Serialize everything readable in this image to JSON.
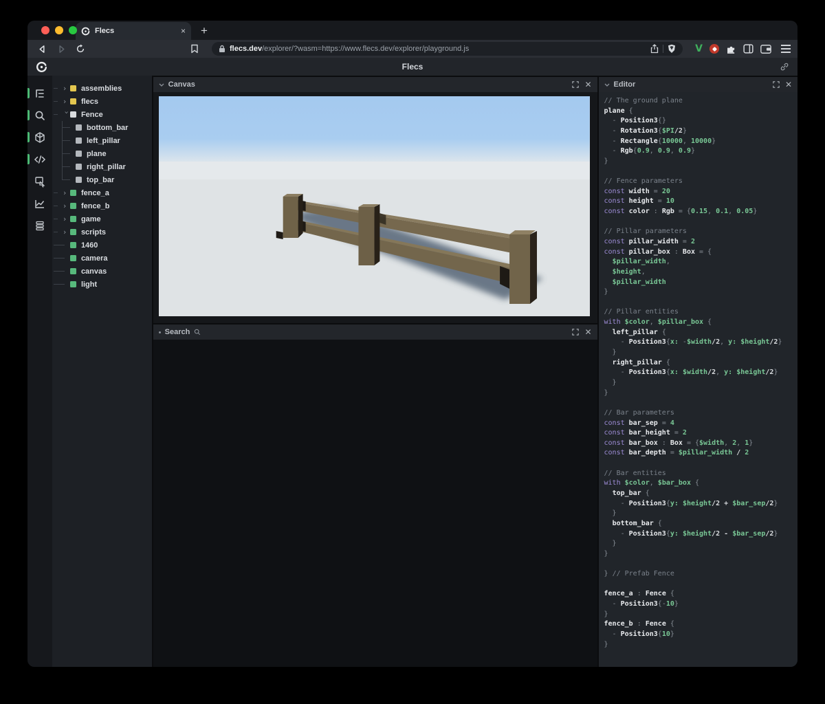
{
  "browser": {
    "tab_title": "Flecs",
    "tab_close": "×",
    "new_tab": "+",
    "url_host": "flecs.dev",
    "url_path": "/explorer/?wasm=https://www.flecs.dev/explorer/playground.js",
    "v_extension_label": "V"
  },
  "header": {
    "title": "Flecs"
  },
  "sidebar_icons": [
    {
      "name": "hierarchy-icon",
      "active": true
    },
    {
      "name": "search-icon",
      "active": true
    },
    {
      "name": "cube-icon",
      "active": true
    },
    {
      "name": "code-icon",
      "active": true
    },
    {
      "name": "inspect-icon",
      "active": false
    },
    {
      "name": "chart-icon",
      "active": false
    },
    {
      "name": "queue-icon",
      "active": false
    }
  ],
  "tree": {
    "items": [
      {
        "label": "assemblies",
        "square": "yellow",
        "state": "collapsed",
        "depth": 0
      },
      {
        "label": "flecs",
        "square": "yellow",
        "state": "collapsed",
        "depth": 0
      },
      {
        "label": "Fence",
        "square": "white",
        "state": "expanded",
        "depth": 0
      },
      {
        "label": "bottom_bar",
        "square": "gray",
        "state": "child",
        "depth": 1,
        "last": false
      },
      {
        "label": "left_pillar",
        "square": "gray",
        "state": "child",
        "depth": 1,
        "last": false
      },
      {
        "label": "plane",
        "square": "gray",
        "state": "child",
        "depth": 1,
        "last": false
      },
      {
        "label": "right_pillar",
        "square": "gray",
        "state": "child",
        "depth": 1,
        "last": false
      },
      {
        "label": "top_bar",
        "square": "gray",
        "state": "child",
        "depth": 1,
        "last": true
      },
      {
        "label": "fence_a",
        "square": "green",
        "state": "collapsed",
        "depth": 0
      },
      {
        "label": "fence_b",
        "square": "green",
        "state": "collapsed",
        "depth": 0
      },
      {
        "label": "game",
        "square": "green",
        "state": "collapsed",
        "depth": 0
      },
      {
        "label": "scripts",
        "square": "green",
        "state": "collapsed",
        "depth": 0
      },
      {
        "label": "1460",
        "square": "green",
        "state": "leaf",
        "depth": 0
      },
      {
        "label": "camera",
        "square": "green",
        "state": "leaf",
        "depth": 0
      },
      {
        "label": "canvas",
        "square": "green",
        "state": "leaf",
        "depth": 0
      },
      {
        "label": "light",
        "square": "green",
        "state": "leaf",
        "depth": 0
      }
    ]
  },
  "panels": {
    "canvas": {
      "title": "Canvas"
    },
    "search": {
      "title": "Search"
    },
    "editor": {
      "title": "Editor"
    }
  },
  "colors": {
    "accent_green": "#4cba74",
    "square_yellow": "#e3c64f",
    "square_white": "#d8dbde",
    "square_gray": "#b4b8bd",
    "square_green": "#57b97c",
    "sky": "#a4c9ef",
    "ground": "#dfe3e5",
    "fence_front": "#73664c",
    "fence_top": "#8a7c60",
    "fence_dark": "#26201a",
    "shadow": "#4e5d6f",
    "traffic_red": "#ff5f57",
    "traffic_yellow": "#febc2e",
    "traffic_green": "#28c840"
  },
  "code": {
    "lines": [
      [
        [
          "c",
          "// The ground plane"
        ]
      ],
      [
        [
          "i",
          "plane"
        ],
        [
          "o",
          " {"
        ]
      ],
      [
        [
          "o",
          "  - "
        ],
        [
          "i",
          "Position3"
        ],
        [
          "o",
          "{}"
        ]
      ],
      [
        [
          "o",
          "  - "
        ],
        [
          "i",
          "Rotation3"
        ],
        [
          "o",
          "{"
        ],
        [
          "v",
          "$PI"
        ],
        [
          "p",
          "/2"
        ],
        [
          "o",
          "}"
        ]
      ],
      [
        [
          "o",
          "  - "
        ],
        [
          "i",
          "Rectangle"
        ],
        [
          "o",
          "{"
        ],
        [
          "v",
          "10000"
        ],
        [
          "o",
          ", "
        ],
        [
          "v",
          "10000"
        ],
        [
          "o",
          "}"
        ]
      ],
      [
        [
          "o",
          "  - "
        ],
        [
          "i",
          "Rgb"
        ],
        [
          "o",
          "{"
        ],
        [
          "v",
          "0.9"
        ],
        [
          "o",
          ", "
        ],
        [
          "v",
          "0.9"
        ],
        [
          "o",
          ", "
        ],
        [
          "v",
          "0.9"
        ],
        [
          "o",
          "}"
        ]
      ],
      [
        [
          "o",
          "}"
        ]
      ],
      [],
      [
        [
          "c",
          "// Fence parameters"
        ]
      ],
      [
        [
          "k",
          "const "
        ],
        [
          "i",
          "width"
        ],
        [
          "o",
          " = "
        ],
        [
          "v",
          "20"
        ]
      ],
      [
        [
          "k",
          "const "
        ],
        [
          "i",
          "height"
        ],
        [
          "o",
          " = "
        ],
        [
          "v",
          "10"
        ]
      ],
      [
        [
          "k",
          "const "
        ],
        [
          "i",
          "color"
        ],
        [
          "o",
          " : "
        ],
        [
          "i",
          "Rgb"
        ],
        [
          "o",
          " = {"
        ],
        [
          "v",
          "0.15"
        ],
        [
          "o",
          ", "
        ],
        [
          "v",
          "0.1"
        ],
        [
          "o",
          ", "
        ],
        [
          "v",
          "0.05"
        ],
        [
          "o",
          "}"
        ]
      ],
      [],
      [
        [
          "c",
          "// Pillar parameters"
        ]
      ],
      [
        [
          "k",
          "const "
        ],
        [
          "i",
          "pillar_width"
        ],
        [
          "o",
          " = "
        ],
        [
          "v",
          "2"
        ]
      ],
      [
        [
          "k",
          "const "
        ],
        [
          "i",
          "pillar_box"
        ],
        [
          "o",
          " : "
        ],
        [
          "i",
          "Box"
        ],
        [
          "o",
          " = {"
        ]
      ],
      [
        [
          "o",
          "  "
        ],
        [
          "v",
          "$pillar_width"
        ],
        [
          "o",
          ","
        ]
      ],
      [
        [
          "o",
          "  "
        ],
        [
          "v",
          "$height"
        ],
        [
          "o",
          ","
        ]
      ],
      [
        [
          "o",
          "  "
        ],
        [
          "v",
          "$pillar_width"
        ]
      ],
      [
        [
          "o",
          "}"
        ]
      ],
      [],
      [
        [
          "c",
          "// Pillar entities"
        ]
      ],
      [
        [
          "k",
          "with "
        ],
        [
          "v",
          "$color"
        ],
        [
          "o",
          ", "
        ],
        [
          "v",
          "$pillar_box"
        ],
        [
          "o",
          " {"
        ]
      ],
      [
        [
          "o",
          "  "
        ],
        [
          "i",
          "left_pillar"
        ],
        [
          "o",
          " {"
        ]
      ],
      [
        [
          "o",
          "    - "
        ],
        [
          "i",
          "Position3"
        ],
        [
          "o",
          "{"
        ],
        [
          "v",
          "x:"
        ],
        [
          "o",
          " -"
        ],
        [
          "v",
          "$width"
        ],
        [
          "p",
          "/2"
        ],
        [
          "o",
          ", "
        ],
        [
          "v",
          "y:"
        ],
        [
          "o",
          " "
        ],
        [
          "v",
          "$height"
        ],
        [
          "p",
          "/2"
        ],
        [
          "o",
          "}"
        ]
      ],
      [
        [
          "o",
          "  }"
        ]
      ],
      [
        [
          "o",
          "  "
        ],
        [
          "i",
          "right_pillar"
        ],
        [
          "o",
          " {"
        ]
      ],
      [
        [
          "o",
          "    - "
        ],
        [
          "i",
          "Position3"
        ],
        [
          "o",
          "{"
        ],
        [
          "v",
          "x:"
        ],
        [
          "o",
          " "
        ],
        [
          "v",
          "$width"
        ],
        [
          "p",
          "/2"
        ],
        [
          "o",
          ", "
        ],
        [
          "v",
          "y:"
        ],
        [
          "o",
          " "
        ],
        [
          "v",
          "$height"
        ],
        [
          "p",
          "/2"
        ],
        [
          "o",
          "}"
        ]
      ],
      [
        [
          "o",
          "  }"
        ]
      ],
      [
        [
          "o",
          "}"
        ]
      ],
      [],
      [
        [
          "c",
          "// Bar parameters"
        ]
      ],
      [
        [
          "k",
          "const "
        ],
        [
          "i",
          "bar_sep"
        ],
        [
          "o",
          " = "
        ],
        [
          "v",
          "4"
        ]
      ],
      [
        [
          "k",
          "const "
        ],
        [
          "i",
          "bar_height"
        ],
        [
          "o",
          " = "
        ],
        [
          "v",
          "2"
        ]
      ],
      [
        [
          "k",
          "const "
        ],
        [
          "i",
          "bar_box"
        ],
        [
          "o",
          " : "
        ],
        [
          "i",
          "Box"
        ],
        [
          "o",
          " = {"
        ],
        [
          "v",
          "$width"
        ],
        [
          "o",
          ", "
        ],
        [
          "v",
          "2"
        ],
        [
          "o",
          ", "
        ],
        [
          "v",
          "1"
        ],
        [
          "o",
          "}"
        ]
      ],
      [
        [
          "k",
          "const "
        ],
        [
          "i",
          "bar_depth"
        ],
        [
          "o",
          " = "
        ],
        [
          "v",
          "$pillar_width"
        ],
        [
          "p",
          " / "
        ],
        [
          "v",
          "2"
        ]
      ],
      [],
      [
        [
          "c",
          "// Bar entities"
        ]
      ],
      [
        [
          "k",
          "with "
        ],
        [
          "v",
          "$color"
        ],
        [
          "o",
          ", "
        ],
        [
          "v",
          "$bar_box"
        ],
        [
          "o",
          " {"
        ]
      ],
      [
        [
          "o",
          "  "
        ],
        [
          "i",
          "top_bar"
        ],
        [
          "o",
          " {"
        ]
      ],
      [
        [
          "o",
          "    - "
        ],
        [
          "i",
          "Position3"
        ],
        [
          "o",
          "{"
        ],
        [
          "v",
          "y:"
        ],
        [
          "o",
          " "
        ],
        [
          "v",
          "$height"
        ],
        [
          "p",
          "/2 + "
        ],
        [
          "v",
          "$bar_sep"
        ],
        [
          "p",
          "/2"
        ],
        [
          "o",
          "}"
        ]
      ],
      [
        [
          "o",
          "  }"
        ]
      ],
      [
        [
          "o",
          "  "
        ],
        [
          "i",
          "bottom_bar"
        ],
        [
          "o",
          " {"
        ]
      ],
      [
        [
          "o",
          "    - "
        ],
        [
          "i",
          "Position3"
        ],
        [
          "o",
          "{"
        ],
        [
          "v",
          "y:"
        ],
        [
          "o",
          " "
        ],
        [
          "v",
          "$height"
        ],
        [
          "p",
          "/2 - "
        ],
        [
          "v",
          "$bar_sep"
        ],
        [
          "p",
          "/2"
        ],
        [
          "o",
          "}"
        ]
      ],
      [
        [
          "o",
          "  }"
        ]
      ],
      [
        [
          "o",
          "}"
        ]
      ],
      [],
      [
        [
          "o",
          "} "
        ],
        [
          "c",
          "// Prefab Fence"
        ]
      ],
      [],
      [
        [
          "i",
          "fence_a"
        ],
        [
          "o",
          " : "
        ],
        [
          "i",
          "Fence"
        ],
        [
          "o",
          " {"
        ]
      ],
      [
        [
          "o",
          "  - "
        ],
        [
          "i",
          "Position3"
        ],
        [
          "o",
          "{-"
        ],
        [
          "v",
          "10"
        ],
        [
          "o",
          "}"
        ]
      ],
      [
        [
          "o",
          "}"
        ]
      ],
      [
        [
          "i",
          "fence_b"
        ],
        [
          "o",
          " : "
        ],
        [
          "i",
          "Fence"
        ],
        [
          "o",
          " {"
        ]
      ],
      [
        [
          "o",
          "  - "
        ],
        [
          "i",
          "Position3"
        ],
        [
          "o",
          "{"
        ],
        [
          "v",
          "10"
        ],
        [
          "o",
          "}"
        ]
      ],
      [
        [
          "o",
          "}"
        ]
      ]
    ]
  }
}
